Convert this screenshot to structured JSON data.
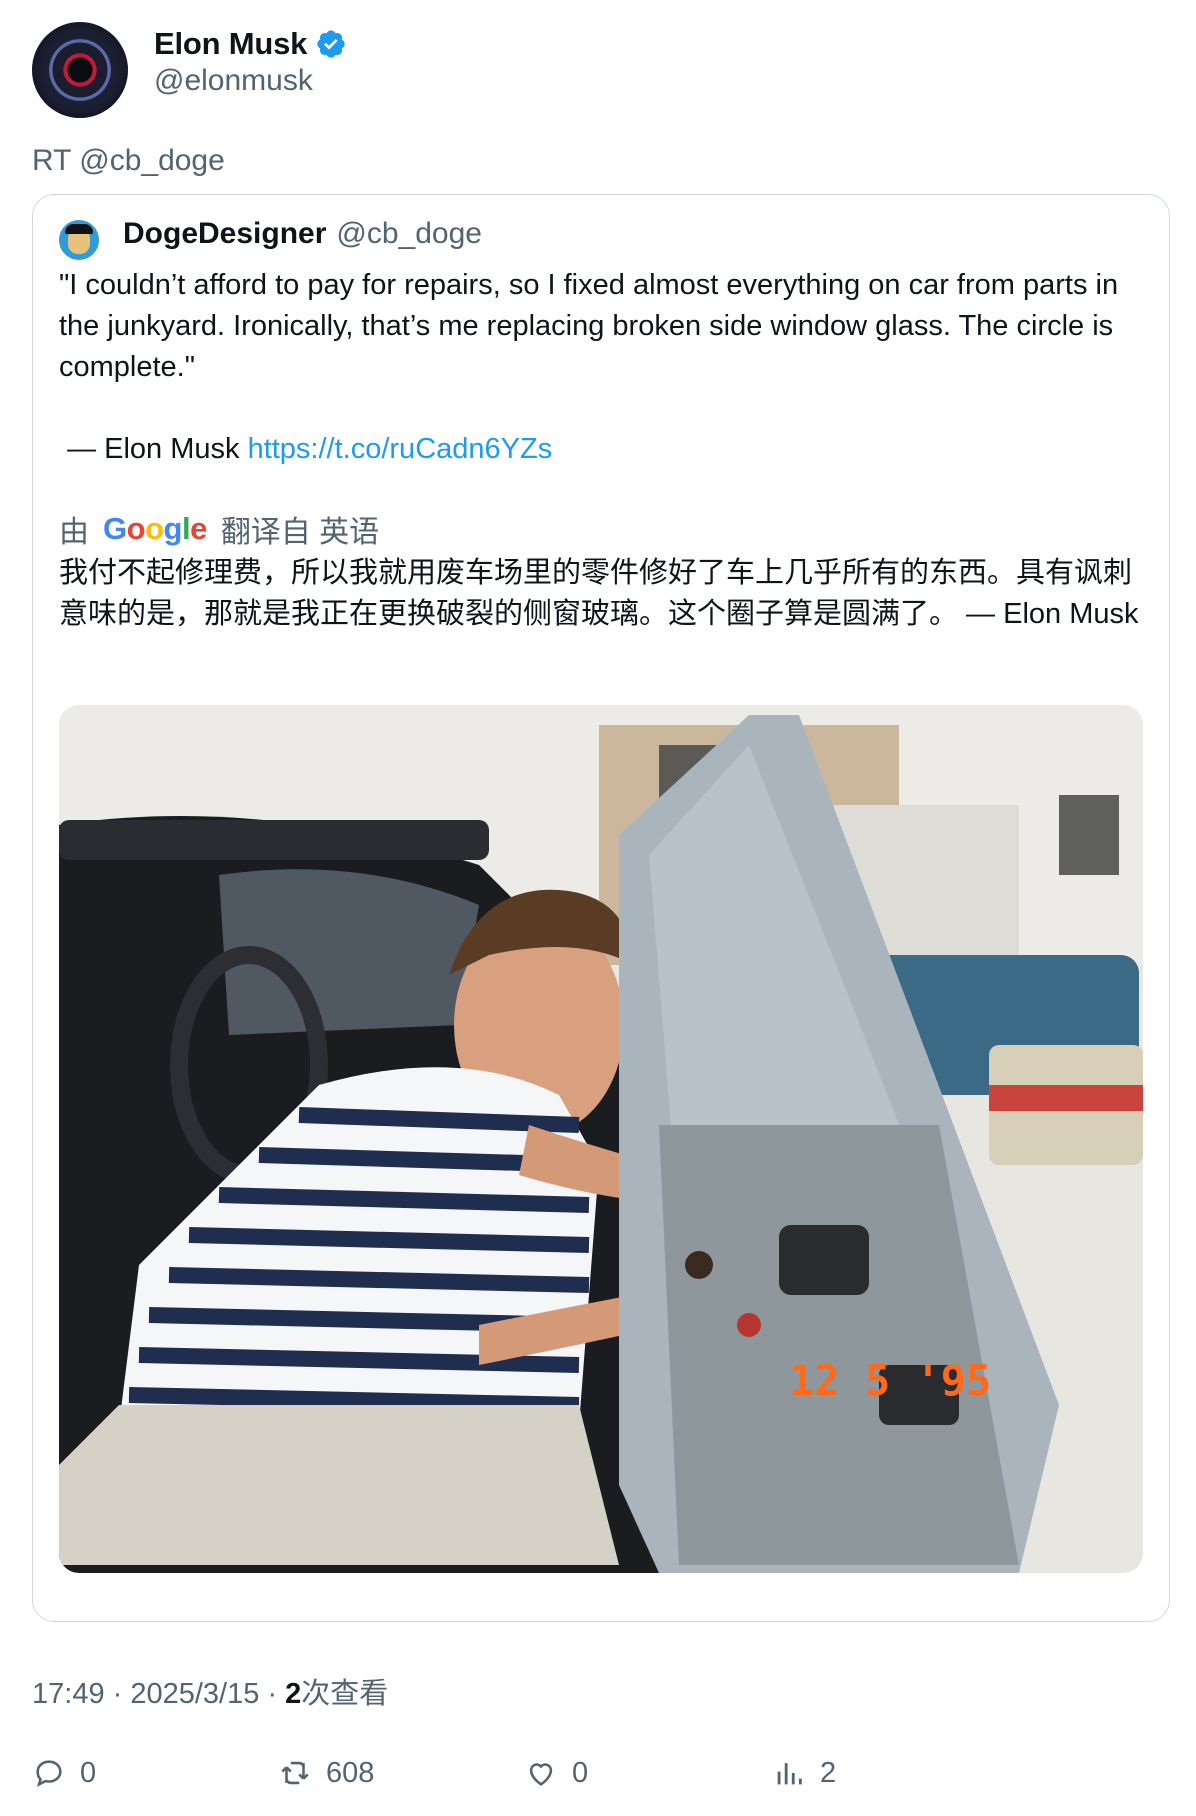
{
  "author": {
    "display_name": "Elon Musk",
    "handle": "@elonmusk",
    "verified": true
  },
  "retweet_label": "RT @cb_doge",
  "quoted": {
    "display_name": "DogeDesigner",
    "handle": "@cb_doge",
    "text": "\"I couldn’t afford to pay for repairs, so I fixed almost everything on car from parts in the junkyard. Ironically, that’s me replacing broken side window glass. The circle is complete.\"\n\n — Elon Musk ",
    "link_text": "https://t.co/ruCadn6YZs",
    "translate_prefix": "由",
    "translate_provider": "Google",
    "translate_suffix": "翻译自 英语",
    "translated_text": "我付不起修理费，所以我就用废车场里的零件修好了车上几乎所有的东西。具有讽刺意味的是，那就是我正在更换破裂的侧窗玻璃。这个圈子算是圆满了。 — Elon Musk",
    "photo_date_stamp": "12  5 '95"
  },
  "meta": {
    "time": "17:49",
    "date": "2025/3/15",
    "views_count": "2",
    "views_label": "次查看"
  },
  "actions": {
    "replies": "0",
    "retweets": "608",
    "likes": "0",
    "views": "2"
  },
  "colors": {
    "accent": "#1d9bf0",
    "text_secondary": "#536471",
    "border": "#cfd9de"
  }
}
